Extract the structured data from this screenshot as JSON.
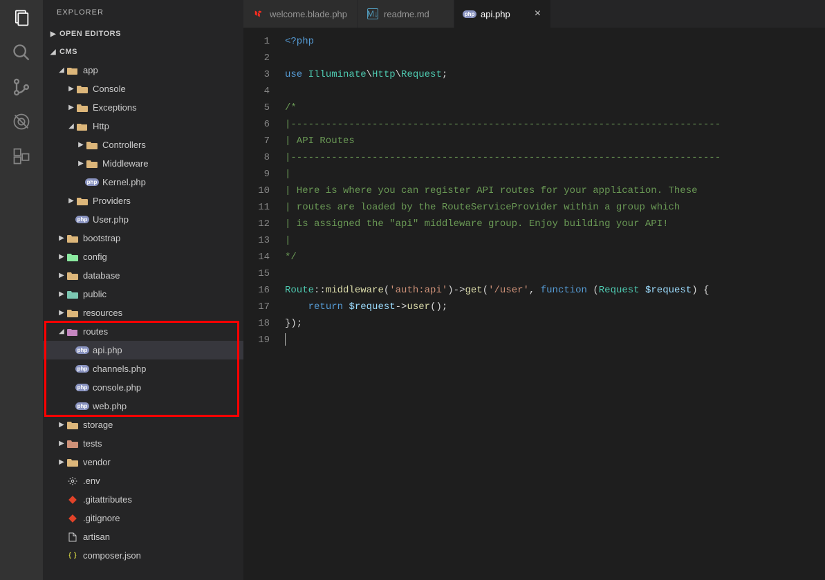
{
  "sidebar": {
    "title": "EXPLORER",
    "sections": {
      "open_editors": "OPEN EDITORS",
      "project": "CMS"
    }
  },
  "activity": {
    "explorer": "Explorer",
    "search": "Search",
    "scm": "Source Control",
    "debug": "Debug",
    "extensions": "Extensions"
  },
  "tree": [
    {
      "label": "app",
      "depth": 1,
      "kind": "folder-open",
      "expanded": true
    },
    {
      "label": "Console",
      "depth": 2,
      "kind": "folder",
      "expanded": false
    },
    {
      "label": "Exceptions",
      "depth": 2,
      "kind": "folder",
      "expanded": false
    },
    {
      "label": "Http",
      "depth": 2,
      "kind": "folder-open",
      "expanded": true
    },
    {
      "label": "Controllers",
      "depth": 3,
      "kind": "folder",
      "expanded": false
    },
    {
      "label": "Middleware",
      "depth": 3,
      "kind": "folder",
      "expanded": false
    },
    {
      "label": "Kernel.php",
      "depth": 3,
      "kind": "php"
    },
    {
      "label": "Providers",
      "depth": 2,
      "kind": "folder",
      "expanded": false
    },
    {
      "label": "User.php",
      "depth": 2,
      "kind": "php"
    },
    {
      "label": "bootstrap",
      "depth": 1,
      "kind": "folder",
      "expanded": false
    },
    {
      "label": "config",
      "depth": 1,
      "kind": "folder-config",
      "expanded": false
    },
    {
      "label": "database",
      "depth": 1,
      "kind": "folder-db",
      "expanded": false
    },
    {
      "label": "public",
      "depth": 1,
      "kind": "folder-public",
      "expanded": false
    },
    {
      "label": "resources",
      "depth": 1,
      "kind": "folder",
      "expanded": false
    },
    {
      "label": "routes",
      "depth": 1,
      "kind": "folder-routes",
      "expanded": true
    },
    {
      "label": "api.php",
      "depth": 2,
      "kind": "php",
      "selected": true
    },
    {
      "label": "channels.php",
      "depth": 2,
      "kind": "php"
    },
    {
      "label": "console.php",
      "depth": 2,
      "kind": "php"
    },
    {
      "label": "web.php",
      "depth": 2,
      "kind": "php"
    },
    {
      "label": "storage",
      "depth": 1,
      "kind": "folder",
      "expanded": false
    },
    {
      "label": "tests",
      "depth": 1,
      "kind": "folder-tests",
      "expanded": false
    },
    {
      "label": "vendor",
      "depth": 1,
      "kind": "folder",
      "expanded": false
    },
    {
      "label": ".env",
      "depth": 1,
      "kind": "gear"
    },
    {
      "label": ".gitattributes",
      "depth": 1,
      "kind": "git"
    },
    {
      "label": ".gitignore",
      "depth": 1,
      "kind": "git"
    },
    {
      "label": "artisan",
      "depth": 1,
      "kind": "file"
    },
    {
      "label": "composer.json",
      "depth": 1,
      "kind": "json"
    }
  ],
  "highlight": {
    "start_index": 14,
    "end_index": 18
  },
  "tabs": [
    {
      "label": "welcome.blade.php",
      "icon": "laravel",
      "active": false
    },
    {
      "label": "readme.md",
      "icon": "md",
      "active": false
    },
    {
      "label": "api.php",
      "icon": "php",
      "active": true,
      "close": "×"
    }
  ],
  "code": {
    "lines": [
      [
        {
          "t": "<?php",
          "c": "tok-kw"
        }
      ],
      [],
      [
        {
          "t": "use ",
          "c": "tok-kw"
        },
        {
          "t": "Illuminate",
          "c": "tok-type"
        },
        {
          "t": "\\",
          "c": "tok-ns"
        },
        {
          "t": "Http",
          "c": "tok-type"
        },
        {
          "t": "\\",
          "c": "tok-ns"
        },
        {
          "t": "Request",
          "c": "tok-type"
        },
        {
          "t": ";",
          "c": "tok-punc"
        }
      ],
      [],
      [
        {
          "t": "/*",
          "c": "tok-comment"
        }
      ],
      [
        {
          "t": "|--------------------------------------------------------------------------",
          "c": "tok-comment"
        }
      ],
      [
        {
          "t": "| API Routes",
          "c": "tok-comment"
        }
      ],
      [
        {
          "t": "|--------------------------------------------------------------------------",
          "c": "tok-comment"
        }
      ],
      [
        {
          "t": "|",
          "c": "tok-comment"
        }
      ],
      [
        {
          "t": "| Here is where you can register API routes for your application. These",
          "c": "tok-comment"
        }
      ],
      [
        {
          "t": "| routes are loaded by the RouteServiceProvider within a group which",
          "c": "tok-comment"
        }
      ],
      [
        {
          "t": "| is assigned the \"api\" middleware group. Enjoy building your API!",
          "c": "tok-comment"
        }
      ],
      [
        {
          "t": "|",
          "c": "tok-comment"
        }
      ],
      [
        {
          "t": "*/",
          "c": "tok-comment"
        }
      ],
      [],
      [
        {
          "t": "Route",
          "c": "tok-type"
        },
        {
          "t": "::",
          "c": "tok-punc"
        },
        {
          "t": "middleware",
          "c": "tok-fn"
        },
        {
          "t": "(",
          "c": "tok-punc"
        },
        {
          "t": "'auth:api'",
          "c": "tok-str"
        },
        {
          "t": ")->",
          "c": "tok-punc"
        },
        {
          "t": "get",
          "c": "tok-fn"
        },
        {
          "t": "(",
          "c": "tok-punc"
        },
        {
          "t": "'/user'",
          "c": "tok-str"
        },
        {
          "t": ", ",
          "c": "tok-punc"
        },
        {
          "t": "function",
          "c": "tok-kw"
        },
        {
          "t": " (",
          "c": "tok-punc"
        },
        {
          "t": "Request",
          "c": "tok-type"
        },
        {
          "t": " ",
          "c": ""
        },
        {
          "t": "$request",
          "c": "tok-var"
        },
        {
          "t": ") {",
          "c": "tok-punc"
        }
      ],
      [
        {
          "t": "    ",
          "c": ""
        },
        {
          "t": "return",
          "c": "tok-kw"
        },
        {
          "t": " ",
          "c": ""
        },
        {
          "t": "$request",
          "c": "tok-var"
        },
        {
          "t": "->",
          "c": "tok-punc"
        },
        {
          "t": "user",
          "c": "tok-fn"
        },
        {
          "t": "();",
          "c": "tok-punc"
        }
      ],
      [
        {
          "t": "});",
          "c": "tok-punc"
        }
      ],
      [
        {
          "t": "",
          "c": "",
          "caret": true
        }
      ]
    ]
  }
}
